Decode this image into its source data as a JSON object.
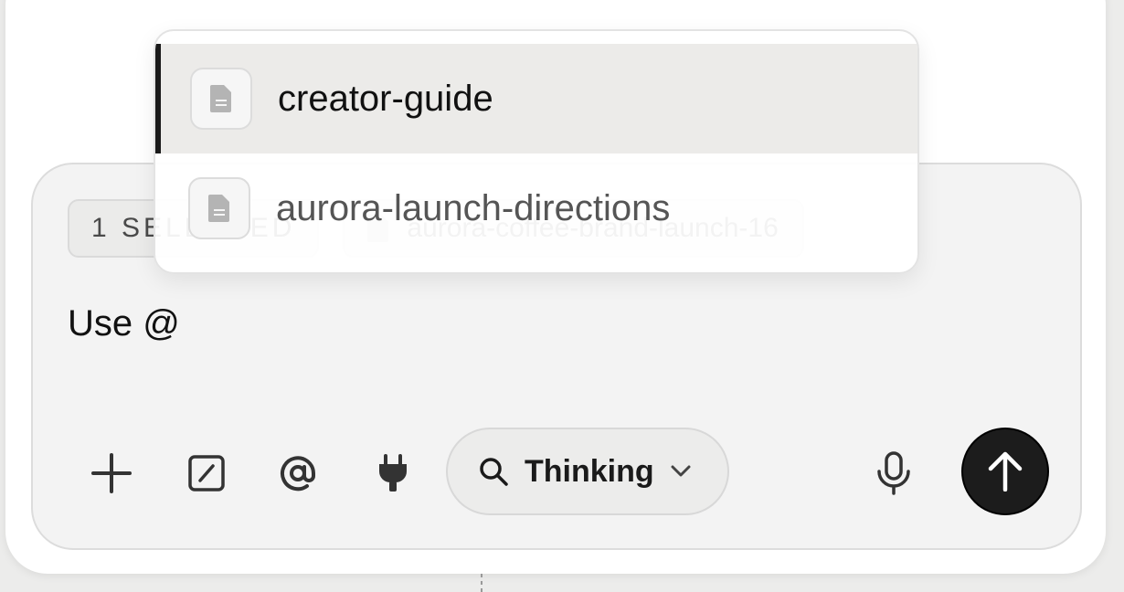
{
  "composer": {
    "selected_chip": "1 SELECTED",
    "file_chip": "aurora-coffee-brand-launch-16",
    "input_value": "Use @"
  },
  "mention_menu": {
    "items": [
      {
        "label": "creator-guide",
        "icon": "document-icon",
        "highlighted": true
      },
      {
        "label": "aurora-launch-directions",
        "icon": "document-icon",
        "highlighted": false
      }
    ]
  },
  "toolbar": {
    "mode_label": "Thinking",
    "icons": [
      "plus-icon",
      "slash-command-icon",
      "at-mention-icon",
      "plug-icon",
      "search-icon",
      "chevron-down-icon",
      "microphone-icon",
      "arrow-up-icon"
    ]
  },
  "colors": {
    "send_button": "#1c1c1c",
    "composer_bg": "#f3f3f3",
    "highlight_row": "#ecebe9"
  }
}
